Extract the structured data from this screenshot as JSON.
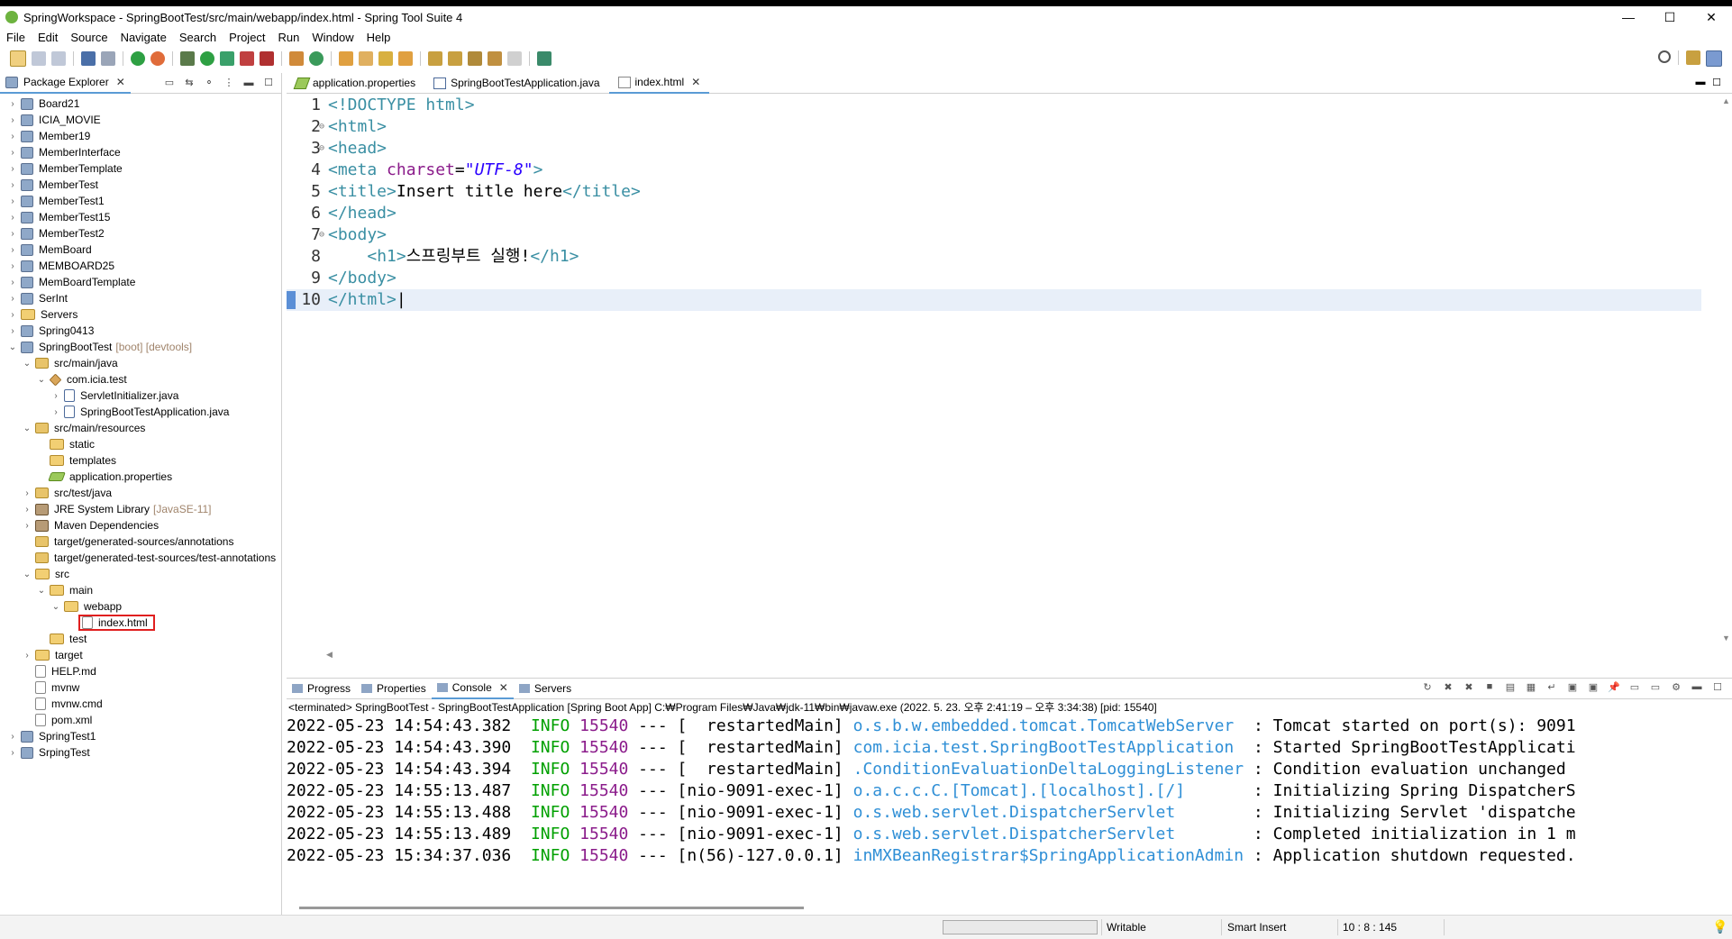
{
  "window": {
    "title": "SpringWorkspace - SpringBootTest/src/main/webapp/index.html - Spring Tool Suite 4",
    "controls": {
      "minimize": "—",
      "maximize": "☐",
      "close": "✕"
    }
  },
  "menu": [
    "File",
    "Edit",
    "Source",
    "Navigate",
    "Search",
    "Project",
    "Run",
    "Window",
    "Help"
  ],
  "package_explorer": {
    "tab_label": "Package Explorer",
    "tree": [
      {
        "label": "Board21",
        "depth": 0,
        "chevron": "›",
        "icon": "project-icon"
      },
      {
        "label": "ICIA_MOVIE",
        "depth": 0,
        "chevron": "›",
        "icon": "project-icon"
      },
      {
        "label": "Member19",
        "depth": 0,
        "chevron": "›",
        "icon": "project-icon"
      },
      {
        "label": "MemberInterface",
        "depth": 0,
        "chevron": "›",
        "icon": "project-icon"
      },
      {
        "label": "MemberTemplate",
        "depth": 0,
        "chevron": "›",
        "icon": "project-icon"
      },
      {
        "label": "MemberTest",
        "depth": 0,
        "chevron": "›",
        "icon": "project-icon"
      },
      {
        "label": "MemberTest1",
        "depth": 0,
        "chevron": "›",
        "icon": "project-icon"
      },
      {
        "label": "MemberTest15",
        "depth": 0,
        "chevron": "›",
        "icon": "project-icon"
      },
      {
        "label": "MemberTest2",
        "depth": 0,
        "chevron": "›",
        "icon": "project-icon"
      },
      {
        "label": "MemBoard",
        "depth": 0,
        "chevron": "›",
        "icon": "project-icon"
      },
      {
        "label": "MEMBOARD25",
        "depth": 0,
        "chevron": "›",
        "icon": "project-icon"
      },
      {
        "label": "MemBoardTemplate",
        "depth": 0,
        "chevron": "›",
        "icon": "project-icon"
      },
      {
        "label": "SerInt",
        "depth": 0,
        "chevron": "›",
        "icon": "project-icon"
      },
      {
        "label": "Servers",
        "depth": 0,
        "chevron": "›",
        "icon": "folder-icon"
      },
      {
        "label": "Spring0413",
        "depth": 0,
        "chevron": "›",
        "icon": "project-icon"
      },
      {
        "label": "SpringBootTest",
        "decoration": "[boot] [devtools]",
        "depth": 0,
        "chevron": "⌄",
        "icon": "project-icon"
      },
      {
        "label": "src/main/java",
        "depth": 1,
        "chevron": "⌄",
        "icon": "source-folder-icon"
      },
      {
        "label": "com.icia.test",
        "depth": 2,
        "chevron": "⌄",
        "icon": "package-icon"
      },
      {
        "label": "ServletInitializer.java",
        "depth": 3,
        "chevron": "›",
        "icon": "java-file-icon"
      },
      {
        "label": "SpringBootTestApplication.java",
        "depth": 3,
        "chevron": "›",
        "icon": "java-file-icon"
      },
      {
        "label": "src/main/resources",
        "depth": 1,
        "chevron": "⌄",
        "icon": "source-folder-icon"
      },
      {
        "label": "static",
        "depth": 2,
        "chevron": "",
        "icon": "folder-icon"
      },
      {
        "label": "templates",
        "depth": 2,
        "chevron": "",
        "icon": "folder-icon"
      },
      {
        "label": "application.properties",
        "depth": 2,
        "chevron": "",
        "icon": "properties-file-icon"
      },
      {
        "label": "src/test/java",
        "depth": 1,
        "chevron": "›",
        "icon": "source-folder-icon"
      },
      {
        "label": "JRE System Library",
        "decoration": "[JavaSE-11]",
        "depth": 1,
        "chevron": "›",
        "icon": "library-icon"
      },
      {
        "label": "Maven Dependencies",
        "depth": 1,
        "chevron": "›",
        "icon": "library-icon"
      },
      {
        "label": "target/generated-sources/annotations",
        "depth": 1,
        "chevron": "",
        "icon": "source-folder-icon"
      },
      {
        "label": "target/generated-test-sources/test-annotations",
        "depth": 1,
        "chevron": "",
        "icon": "source-folder-icon"
      },
      {
        "label": "src",
        "depth": 1,
        "chevron": "⌄",
        "icon": "folder-icon"
      },
      {
        "label": "main",
        "depth": 2,
        "chevron": "⌄",
        "icon": "folder-icon"
      },
      {
        "label": "webapp",
        "depth": 3,
        "chevron": "⌄",
        "icon": "folder-icon"
      },
      {
        "label": "index.html",
        "depth": 4,
        "chevron": "",
        "icon": "html-file-icon",
        "highlighted": true
      },
      {
        "label": "test",
        "depth": 2,
        "chevron": "",
        "icon": "folder-icon"
      },
      {
        "label": "target",
        "depth": 1,
        "chevron": "›",
        "icon": "folder-icon"
      },
      {
        "label": "HELP.md",
        "depth": 1,
        "chevron": "",
        "icon": "file-icon"
      },
      {
        "label": "mvnw",
        "depth": 1,
        "chevron": "",
        "icon": "file-icon"
      },
      {
        "label": "mvnw.cmd",
        "depth": 1,
        "chevron": "",
        "icon": "file-icon"
      },
      {
        "label": "pom.xml",
        "depth": 1,
        "chevron": "",
        "icon": "xml-file-icon"
      },
      {
        "label": "SpringTest1",
        "depth": 0,
        "chevron": "›",
        "icon": "project-icon"
      },
      {
        "label": "SrpingTest",
        "depth": 0,
        "chevron": "›",
        "icon": "project-icon"
      }
    ]
  },
  "editor": {
    "tabs": [
      {
        "label": "application.properties",
        "icon": "properties-file-icon",
        "active": false
      },
      {
        "label": "SpringBootTestApplication.java",
        "icon": "java-file-icon",
        "active": false
      },
      {
        "label": "index.html",
        "icon": "html-file-icon",
        "active": true,
        "close": "✕"
      }
    ],
    "lines": [
      {
        "n": "1",
        "fold": "",
        "parts": [
          [
            "tag",
            "<!DOCTYPE html>"
          ]
        ]
      },
      {
        "n": "2",
        "fold": "⊖",
        "parts": [
          [
            "tag",
            "<html>"
          ]
        ]
      },
      {
        "n": "3",
        "fold": "⊖",
        "parts": [
          [
            "tag",
            "<head>"
          ]
        ]
      },
      {
        "n": "4",
        "fold": "",
        "parts": [
          [
            "tag",
            "<meta "
          ],
          [
            "attr",
            "charset"
          ],
          [
            "txt",
            "="
          ],
          [
            "val",
            "\"UTF-8\""
          ],
          [
            "tag",
            ">"
          ]
        ]
      },
      {
        "n": "5",
        "fold": "",
        "parts": [
          [
            "tag",
            "<title>"
          ],
          [
            "txt",
            "Insert title here"
          ],
          [
            "tag",
            "</title>"
          ]
        ]
      },
      {
        "n": "6",
        "fold": "",
        "parts": [
          [
            "tag",
            "</head>"
          ]
        ]
      },
      {
        "n": "7",
        "fold": "⊖",
        "parts": [
          [
            "tag",
            "<body>"
          ]
        ]
      },
      {
        "n": "8",
        "fold": "",
        "parts": [
          [
            "txt",
            "    "
          ],
          [
            "tag",
            "<h1>"
          ],
          [
            "txt",
            "스프링부트 실행!"
          ],
          [
            "tag",
            "</h1>"
          ]
        ]
      },
      {
        "n": "9",
        "fold": "",
        "parts": [
          [
            "tag",
            "</body>"
          ]
        ]
      },
      {
        "n": "10",
        "fold": "",
        "parts": [
          [
            "tag",
            "</html>"
          ]
        ],
        "current": true
      }
    ]
  },
  "console": {
    "tabs": [
      {
        "label": "Progress",
        "icon": "progress-icon",
        "active": false
      },
      {
        "label": "Properties",
        "icon": "properties-icon",
        "active": false
      },
      {
        "label": "Console",
        "icon": "console-icon",
        "active": true,
        "close": "✕"
      },
      {
        "label": "Servers",
        "icon": "servers-icon",
        "active": false
      }
    ],
    "status": "<terminated> SpringBootTest - SpringBootTestApplication [Spring Boot App] C:₩Program Files₩Java₩jdk-11₩bin₩javaw.exe  (2022. 5. 23. 오후 2:41:19 – 오후 3:34:38) [pid: 15540]",
    "lines": [
      {
        "ts": "2022-05-23 14:54:43.382",
        "level": "INFO",
        "pid": "15540",
        "sep": "---",
        "thread": "[  restartedMain]",
        "logger": "o.s.b.w.embedded.tomcat.TomcatWebServer  ",
        "msg": ": Tomcat started on port(s): 9091"
      },
      {
        "ts": "2022-05-23 14:54:43.390",
        "level": "INFO",
        "pid": "15540",
        "sep": "---",
        "thread": "[  restartedMain]",
        "logger": "com.icia.test.SpringBootTestApplication  ",
        "msg": ": Started SpringBootTestApplicati"
      },
      {
        "ts": "2022-05-23 14:54:43.394",
        "level": "INFO",
        "pid": "15540",
        "sep": "---",
        "thread": "[  restartedMain]",
        "logger": ".ConditionEvaluationDeltaLoggingListener",
        "msg": " : Condition evaluation unchanged"
      },
      {
        "ts": "2022-05-23 14:55:13.487",
        "level": "INFO",
        "pid": "15540",
        "sep": "---",
        "thread": "[nio-9091-exec-1]",
        "logger": "o.a.c.c.C.[Tomcat].[localhost].[/]      ",
        "msg": " : Initializing Spring DispatcherS"
      },
      {
        "ts": "2022-05-23 14:55:13.488",
        "level": "INFO",
        "pid": "15540",
        "sep": "---",
        "thread": "[nio-9091-exec-1]",
        "logger": "o.s.web.servlet.DispatcherServlet       ",
        "msg": " : Initializing Servlet 'dispatche"
      },
      {
        "ts": "2022-05-23 14:55:13.489",
        "level": "INFO",
        "pid": "15540",
        "sep": "---",
        "thread": "[nio-9091-exec-1]",
        "logger": "o.s.web.servlet.DispatcherServlet       ",
        "msg": " : Completed initialization in 1 m"
      },
      {
        "ts": "2022-05-23 15:34:37.036",
        "level": "INFO",
        "pid": "15540",
        "sep": "---",
        "thread": "[n(56)-127.0.0.1]",
        "logger": "inMXBeanRegistrar$SpringApplicationAdmin",
        "msg": " : Application shutdown requested."
      }
    ]
  },
  "statusbar": {
    "writable": "Writable",
    "insert_mode": "Smart Insert",
    "position": "10 : 8 : 145"
  },
  "colors": {
    "tag": "#3a8fa3",
    "attr": "#8b1c8b",
    "value": "#2a00ff",
    "info": "#00a000",
    "pid": "#8b1c8b",
    "logger": "#2f8fd6",
    "highlight_box": "#e01f1f"
  }
}
